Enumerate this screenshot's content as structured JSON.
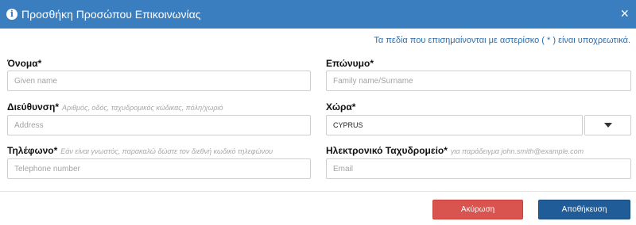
{
  "dialog": {
    "title": "Προσθήκη Προσώπου Επικοινωνίας",
    "close_symbol": "×",
    "required_hint": "Τα πεδία που επισημαίνονται με αστερίσκο ( * ) είναι υποχρεωτικά.",
    "header_color": "#3b7ec0"
  },
  "icons": {
    "title_icon": "info-icon",
    "title_icon_glyph": "i",
    "dropdown_icon": "caret-down-icon"
  },
  "form": {
    "first_name": {
      "label": "Όνομα*",
      "placeholder": "Given name",
      "value": ""
    },
    "last_name": {
      "label": "Επώνυμο*",
      "placeholder": "Family name/Surname",
      "value": ""
    },
    "address": {
      "label": "Διεύθυνση*",
      "hint": "Αριθμός, οδός, ταχυδρομικός κώδικας, πόλη/χωριό",
      "placeholder": "Address",
      "value": ""
    },
    "country": {
      "label": "Χώρα*",
      "value": "CYPRUS"
    },
    "phone": {
      "label": "Τηλέφωνο*",
      "hint": "Εάν είναι γνωστός, παρακαλώ δώστε τον διεθνή κωδικό τηλεφώνου",
      "placeholder": "Telephone number",
      "value": ""
    },
    "email": {
      "label": "Ηλεκτρονικό Ταχυδρομείο*",
      "hint": "για παράδειγμα john.smith@example.com",
      "placeholder": "Email",
      "value": ""
    }
  },
  "buttons": {
    "cancel_label": "Ακύρωση",
    "save_label": "Αποθήκευση",
    "cancel_color": "#d9534f",
    "save_color": "#1f5c98"
  }
}
